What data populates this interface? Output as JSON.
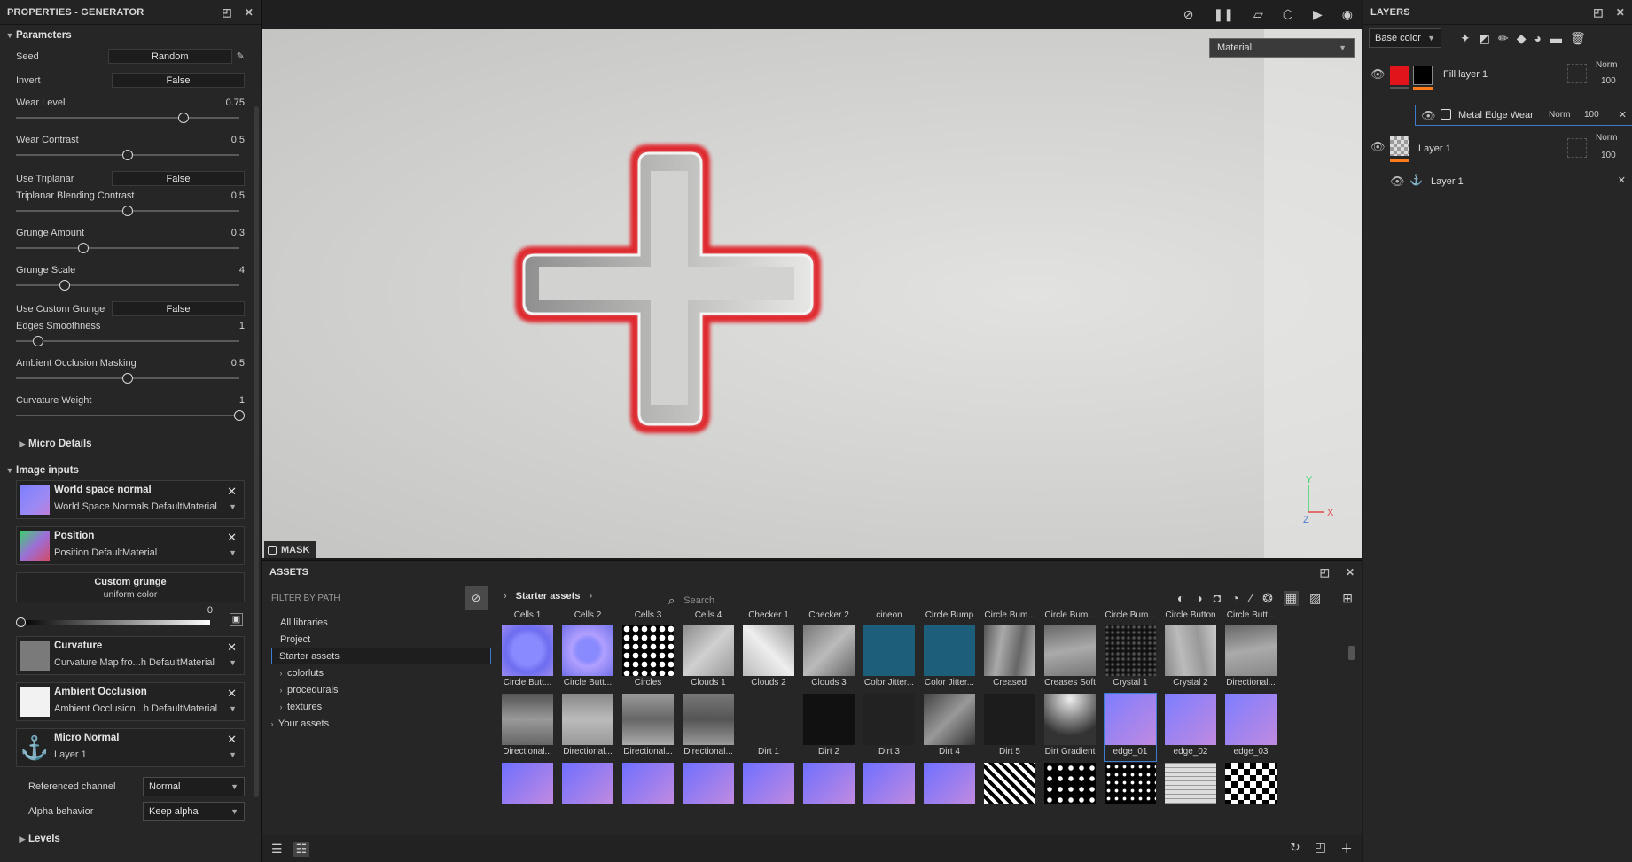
{
  "properties": {
    "title": "PROPERTIES - GENERATOR",
    "section": "Parameters",
    "seed": {
      "label": "Seed",
      "value": "Random"
    },
    "invert": {
      "label": "Invert",
      "value": "False"
    },
    "sliders": [
      {
        "label": "Wear Level",
        "display": "0.75",
        "fraction": 0.75
      },
      {
        "label": "Wear Contrast",
        "display": "0.5",
        "fraction": 0.5
      },
      {
        "label": "Triplanar Blending Contrast",
        "display": "0.5",
        "fraction": 0.5
      },
      {
        "label": "Grunge Amount",
        "display": "0.3",
        "fraction": 0.3
      },
      {
        "label": "Grunge Scale",
        "display": "4",
        "fraction": 0.22
      },
      {
        "label": "Edges Smoothness",
        "display": "1",
        "fraction": 0.1
      },
      {
        "label": "Ambient Occlusion Masking",
        "display": "0.5",
        "fraction": 0.5
      },
      {
        "label": "Curvature Weight",
        "display": "1",
        "fraction": 1.0
      }
    ],
    "use_triplanar": {
      "label": "Use Triplanar",
      "value": "False"
    },
    "use_custom_grunge": {
      "label": "Use Custom Grunge",
      "value": "False"
    },
    "micro_details": "Micro Details",
    "image_inputs": "Image inputs",
    "inputs": [
      {
        "title": "World space normal",
        "value": "World Space Normals DefaultMaterial"
      },
      {
        "title": "Position",
        "value": "Position DefaultMaterial"
      }
    ],
    "custom_grunge": {
      "title": "Custom grunge",
      "sub": "uniform color",
      "value": "0"
    },
    "inputs2": [
      {
        "title": "Curvature",
        "value": "Curvature Map fro...h DefaultMaterial"
      },
      {
        "title": "Ambient Occlusion",
        "value": "Ambient Occlusion...h DefaultMaterial"
      },
      {
        "title": "Micro Normal",
        "value": "Layer 1"
      }
    ],
    "referenced_channel": {
      "label": "Referenced channel",
      "value": "Normal"
    },
    "alpha_behavior": {
      "label": "Alpha behavior",
      "value": "Keep alpha"
    },
    "levels": "Levels"
  },
  "viewport": {
    "material_select": "Material",
    "mask_label": "MASK",
    "axis_labels": {
      "y": "Y",
      "z": "Z",
      "x": "X"
    }
  },
  "layers": {
    "title": "LAYERS",
    "channel": "Base color",
    "items": [
      {
        "name": "Fill layer 1",
        "blend": "Norm",
        "opacity": "100"
      },
      {
        "name": "Metal Edge Wear",
        "blend": "Norm",
        "opacity": "100"
      },
      {
        "name": "Layer 1",
        "blend": "Norm",
        "opacity": "100"
      },
      {
        "name": "Layer 1"
      }
    ]
  },
  "assets": {
    "title": "ASSETS",
    "filter_label": "FILTER BY PATH",
    "tree": [
      "All libraries",
      "Project",
      "Starter assets",
      "colorluts",
      "procedurals",
      "textures",
      "Your assets"
    ],
    "breadcrumb": "Starter assets",
    "search_placeholder": "Search",
    "top_labels": [
      "Cells 1",
      "Cells 2",
      "Cells 3",
      "Cells 4",
      "Checker 1",
      "Checker 2",
      "cineon",
      "Circle Bump",
      "Circle Bum...",
      "Circle Bum...",
      "Circle Bum...",
      "Circle Button",
      "Circle Butt..."
    ],
    "row1": [
      "Circle Butt...",
      "Circle Butt...",
      "Circles",
      "Clouds 1",
      "Clouds 2",
      "Clouds 3",
      "Color Jitter...",
      "Color Jitter...",
      "Creased",
      "Creases Soft",
      "Crystal 1",
      "Crystal 2",
      "Directional..."
    ],
    "row2": [
      "Directional...",
      "Directional...",
      "Directional...",
      "Directional...",
      "Dirt 1",
      "Dirt 2",
      "Dirt 3",
      "Dirt 4",
      "Dirt 5",
      "Dirt Gradient",
      "edge_01",
      "edge_02",
      "edge_03"
    ]
  },
  "colors": {
    "accent": "#3d7bd1",
    "mask_red": "#e0141a"
  }
}
